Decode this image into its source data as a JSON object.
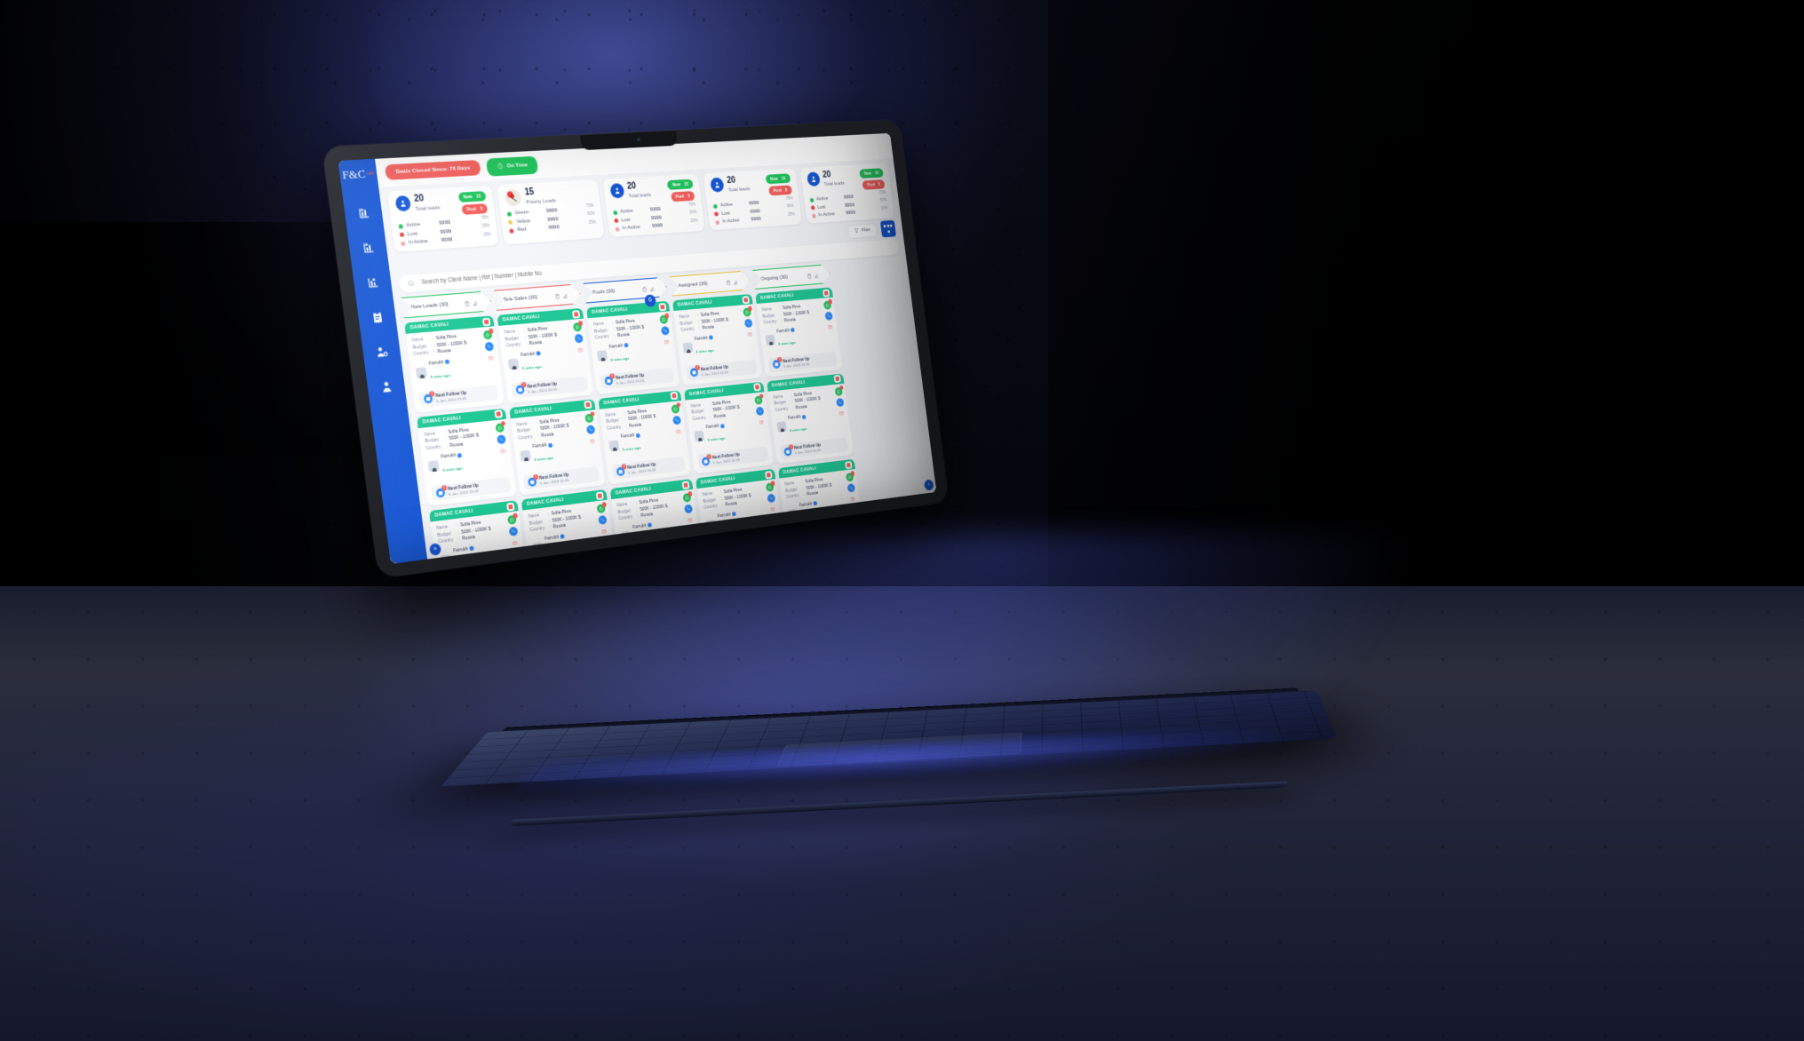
{
  "scene": {
    "device": "laptop",
    "environment": "dark-room"
  },
  "app": {
    "logo": {
      "text": "F&C",
      "sub": "UAE"
    },
    "topbar": {
      "deals_closed": "Deals Closed Since: 76 Days",
      "on_time": "On Time"
    },
    "sidebar": {
      "items": [
        {
          "name": "leads-icon"
        },
        {
          "name": "pipeline-icon"
        },
        {
          "name": "reports-icon"
        },
        {
          "name": "clipboard-icon"
        },
        {
          "name": "user-settings-icon"
        },
        {
          "name": "profile-icon"
        }
      ]
    },
    "stat_cards": [
      {
        "value": "20",
        "label": "Total leads",
        "icon": "avatar-icon",
        "badges": [
          {
            "label": "New",
            "count": "15",
            "color": "#22c55e"
          },
          {
            "label": "Pool",
            "count": "5",
            "color": "#f4605e"
          }
        ],
        "metrics": [
          {
            "name": "Active",
            "value": "9999",
            "pct": "75%",
            "fill": 75,
            "color": "#22c55e"
          },
          {
            "name": "Lost",
            "value": "9999",
            "pct": "50%",
            "fill": 50,
            "color": "#ef4444"
          },
          {
            "name": "In Active",
            "value": "9999",
            "pct": "25%",
            "fill": 25,
            "color": "#f9a8a8"
          }
        ]
      },
      {
        "value": "15",
        "label": "Priority Leads",
        "icon": "pin-icon",
        "badges": [],
        "metrics": [
          {
            "name": "Green",
            "value": "9999",
            "pct": "75%",
            "fill": 75,
            "color": "#22c55e"
          },
          {
            "name": "Yellow",
            "value": "9999",
            "pct": "50%",
            "fill": 50,
            "color": "#f0d264"
          },
          {
            "name": "Red",
            "value": "9999",
            "pct": "25%",
            "fill": 25,
            "color": "#ef4444"
          }
        ]
      },
      {
        "value": "20",
        "label": "Total leads",
        "icon": "avatar-icon",
        "badges": [
          {
            "label": "New",
            "count": "15",
            "color": "#22c55e"
          },
          {
            "label": "Pool",
            "count": "5",
            "color": "#f4605e"
          }
        ],
        "metrics": [
          {
            "name": "Active",
            "value": "9999",
            "pct": "75%",
            "fill": 75,
            "color": "#22c55e"
          },
          {
            "name": "Lost",
            "value": "9999",
            "pct": "50%",
            "fill": 50,
            "color": "#ef4444"
          },
          {
            "name": "In Active",
            "value": "9999",
            "pct": "25%",
            "fill": 25,
            "color": "#f9a8a8"
          }
        ]
      },
      {
        "value": "20",
        "label": "Total leads",
        "icon": "avatar-icon",
        "badges": [
          {
            "label": "New",
            "count": "15",
            "color": "#22c55e"
          },
          {
            "label": "Pool",
            "count": "5",
            "color": "#f4605e"
          }
        ],
        "metrics": [
          {
            "name": "Active",
            "value": "9999",
            "pct": "75%",
            "fill": 75,
            "color": "#22c55e"
          },
          {
            "name": "Lost",
            "value": "9999",
            "pct": "50%",
            "fill": 50,
            "color": "#ef4444"
          },
          {
            "name": "In Active",
            "value": "9999",
            "pct": "25%",
            "fill": 25,
            "color": "#f9a8a8"
          }
        ]
      },
      {
        "value": "20",
        "label": "Total leads",
        "icon": "avatar-icon",
        "badges": [
          {
            "label": "New",
            "count": "15",
            "color": "#22c55e"
          },
          {
            "label": "Pool",
            "count": "5",
            "color": "#f4605e"
          }
        ],
        "metrics": [
          {
            "name": "Active",
            "value": "9999",
            "pct": "75%",
            "fill": 75,
            "color": "#22c55e"
          },
          {
            "name": "Lost",
            "value": "9999",
            "pct": "50%",
            "fill": 50,
            "color": "#ef4444"
          },
          {
            "name": "In Active",
            "value": "9999",
            "pct": "25%",
            "fill": 25,
            "color": "#f9a8a8"
          }
        ]
      }
    ],
    "toolbar": {
      "filter_label": "Filter",
      "grid_view_label": "grid-view"
    },
    "search": {
      "placeholder": "Search by Client Name | Ref | Number | Mobile No.",
      "value": ""
    },
    "board": {
      "columns": [
        {
          "title": "New Leads (30)",
          "color": "#22c55e"
        },
        {
          "title": "Tele Sales (30)",
          "color": "#f4605e"
        },
        {
          "title": "Pools (30)",
          "color": "#1757d6"
        },
        {
          "title": "Assigned (30)",
          "color": "#f0c53a"
        },
        {
          "title": "Ongoing (30)",
          "color": "#22c55e"
        }
      ],
      "card": {
        "title": "DAMAC CAVALI",
        "fields": [
          {
            "key": "Name",
            "value": "Sofia Pires"
          },
          {
            "key": "Budget",
            "value": "500K - 1000K $"
          },
          {
            "key": "Country",
            "value": "Russia"
          }
        ],
        "owner": "Farrukh",
        "owner_time": "5 mins ago",
        "followup_label": "Next Follow Up",
        "followup_date": "5 Jan, 2024 15:45",
        "followup_count": "1",
        "action_counts": {
          "whatsapp": "1",
          "mail": "1",
          "phone": "1"
        }
      },
      "pager": "6",
      "next_arrow": "›",
      "prev_arrow": "»"
    }
  }
}
